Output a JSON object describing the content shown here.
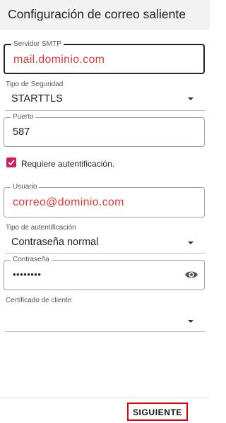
{
  "header": {
    "title": "Configuración de correo saliente"
  },
  "smtp_server": {
    "label": "Servidor SMTP",
    "value": "mail.dominio.com"
  },
  "security": {
    "label": "Tipo de Seguridad",
    "value": "STARTTLS"
  },
  "port": {
    "label": "Puerto",
    "value": "587"
  },
  "require_auth": {
    "label": "Requiere autentificación.",
    "checked": true
  },
  "username": {
    "label": "Usuario",
    "value": "correo@dominio.com"
  },
  "auth_type": {
    "label": "Tipo de autentificación",
    "value": "Contraseña normal"
  },
  "password": {
    "label": "Contraseña",
    "masked": "••••••••"
  },
  "client_cert": {
    "label": "Certificado de cliente",
    "value": ""
  },
  "footer": {
    "next_label": "SIGUIENTE"
  },
  "colors": {
    "accent": "#d81b60",
    "highlight_red": "#e53935",
    "button_outline": "#e10000"
  },
  "icons": {
    "dropdown": "caret-down-icon",
    "visibility": "eye-icon",
    "checkbox": "check-icon"
  }
}
